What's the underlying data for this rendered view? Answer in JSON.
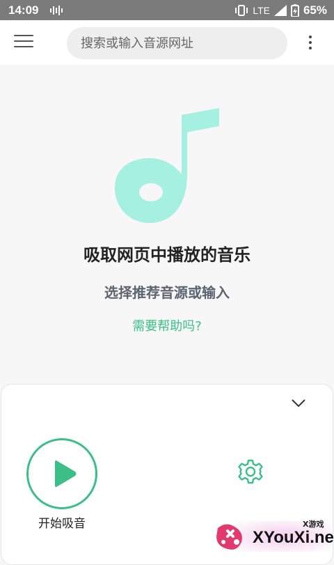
{
  "status_bar": {
    "time": "14:09",
    "network": "LTE",
    "battery_percent": "65%",
    "icons": [
      "audio-wave-icon",
      "vibrate-icon",
      "signal-icon",
      "battery-charging-icon"
    ]
  },
  "app_bar": {
    "menu_icon": "hamburger-menu-icon",
    "search_placeholder": "搜索或输入音源网址",
    "search_value": "",
    "more_icon": "more-vert-icon"
  },
  "hero": {
    "icon": "music-note-icon",
    "icon_color": "#a6f0e1",
    "title": "吸取网页中播放的音乐",
    "subtitle": "选择推荐音源或输入",
    "help_link": "需要帮助吗?"
  },
  "panel": {
    "collapse_icon": "chevron-down-icon",
    "start_button_label": "开始吸音",
    "start_icon": "play-icon",
    "settings_icon": "gear-icon",
    "accent_color": "#3bbf87"
  },
  "watermark": {
    "small_text": "X游戏",
    "text": "XYouXi.net"
  }
}
